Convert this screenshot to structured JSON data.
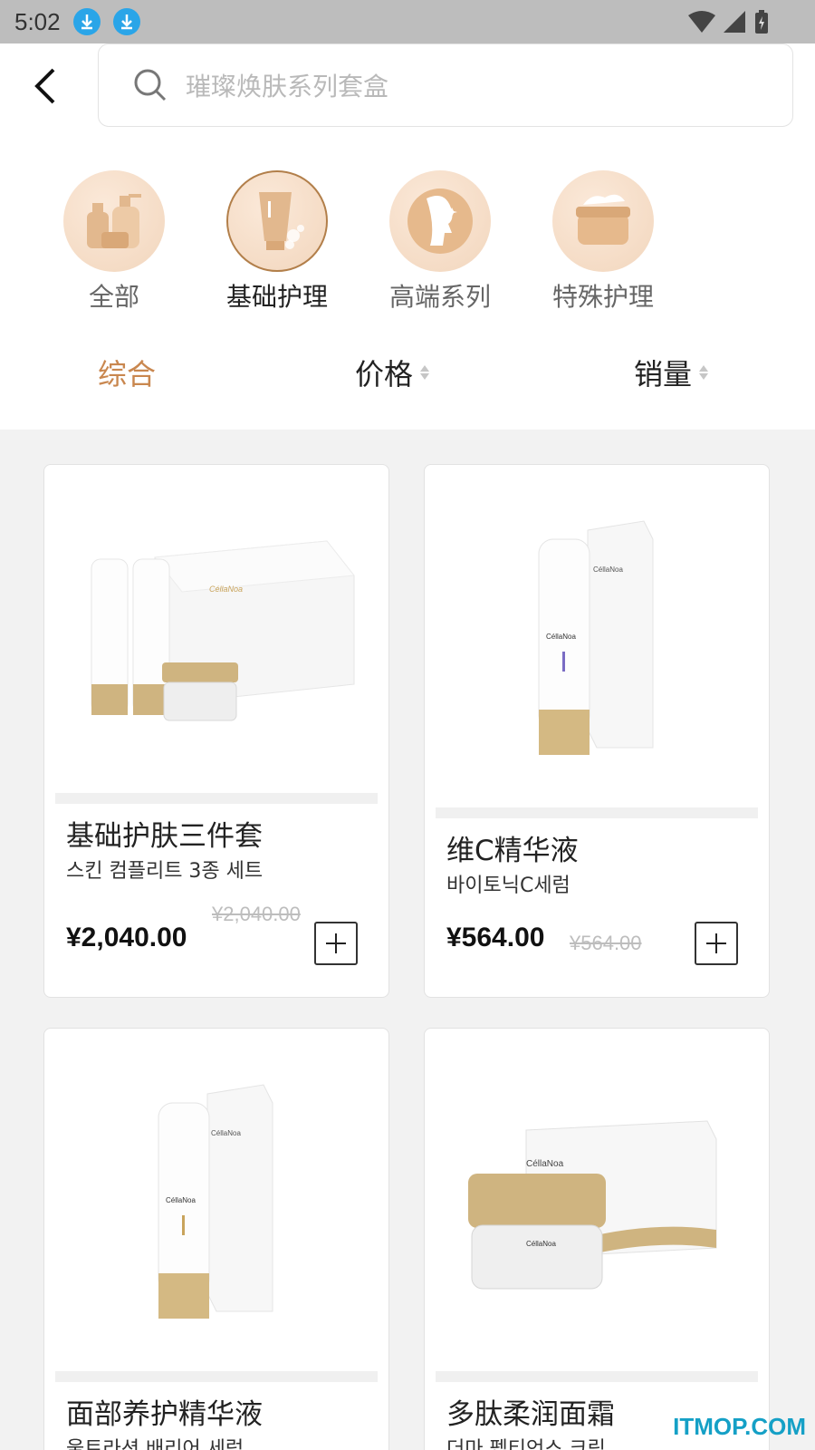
{
  "status_bar": {
    "time": "5:02"
  },
  "search": {
    "placeholder": "璀璨焕肤系列套盒"
  },
  "categories": [
    {
      "label": "全部",
      "icon": "bottles-icon"
    },
    {
      "label": "基础护理",
      "icon": "tube-icon"
    },
    {
      "label": "高端系列",
      "icon": "face-icon"
    },
    {
      "label": "特殊护理",
      "icon": "cream-jar-icon"
    }
  ],
  "active_category": "基础护理",
  "sort": {
    "comprehensive": "综合",
    "price": "价格",
    "sales": "销量"
  },
  "products": [
    {
      "title": "基础护肤三件套",
      "subtitle": "스킨 컴플리트 3종 세트",
      "price": "¥2,040.00",
      "old_price": "¥2,040.00",
      "brand": "CéllaNoa"
    },
    {
      "title": "维C精华液",
      "subtitle": "바이토닉C세럼",
      "price": "¥564.00",
      "old_price": "¥564.00",
      "brand": "CéllaNoa"
    },
    {
      "title": "面部养护精华液",
      "subtitle": "울트라션 배리어 세럼",
      "brand": "CéllaNoa"
    },
    {
      "title": "多肽柔润面霜",
      "subtitle": "더마 펩티언스 크림",
      "brand": "CéllaNoa"
    }
  ],
  "watermark": "ITMOP.COM",
  "colors": {
    "accent": "#c9874f",
    "status_bar": "#bdbdbd",
    "background": "#f2f2f2"
  }
}
